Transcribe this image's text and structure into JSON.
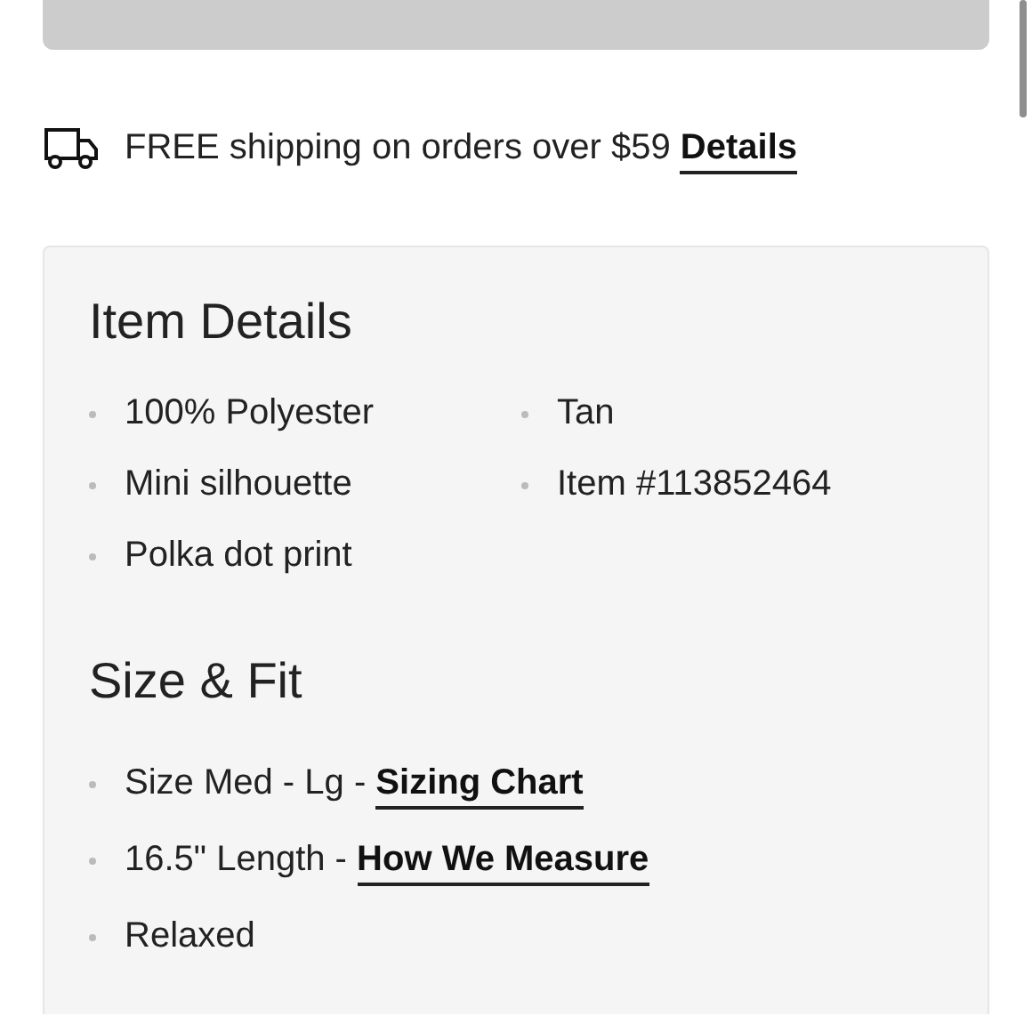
{
  "sold_button": {
    "disabled": true
  },
  "shipping": {
    "text": "FREE shipping on orders over $59",
    "link": "Details"
  },
  "item_details": {
    "title": "Item Details",
    "items": [
      "100% Polyester",
      "Mini silhouette",
      "Polka dot print",
      "Tan",
      "Item #113852464"
    ]
  },
  "size_fit": {
    "title": "Size & Fit",
    "items": [
      {
        "text": "Size Med - Lg -",
        "link": "Sizing Chart"
      },
      {
        "text": "16.5\" Length -",
        "link": "How We Measure"
      },
      {
        "text": "Relaxed"
      }
    ]
  }
}
